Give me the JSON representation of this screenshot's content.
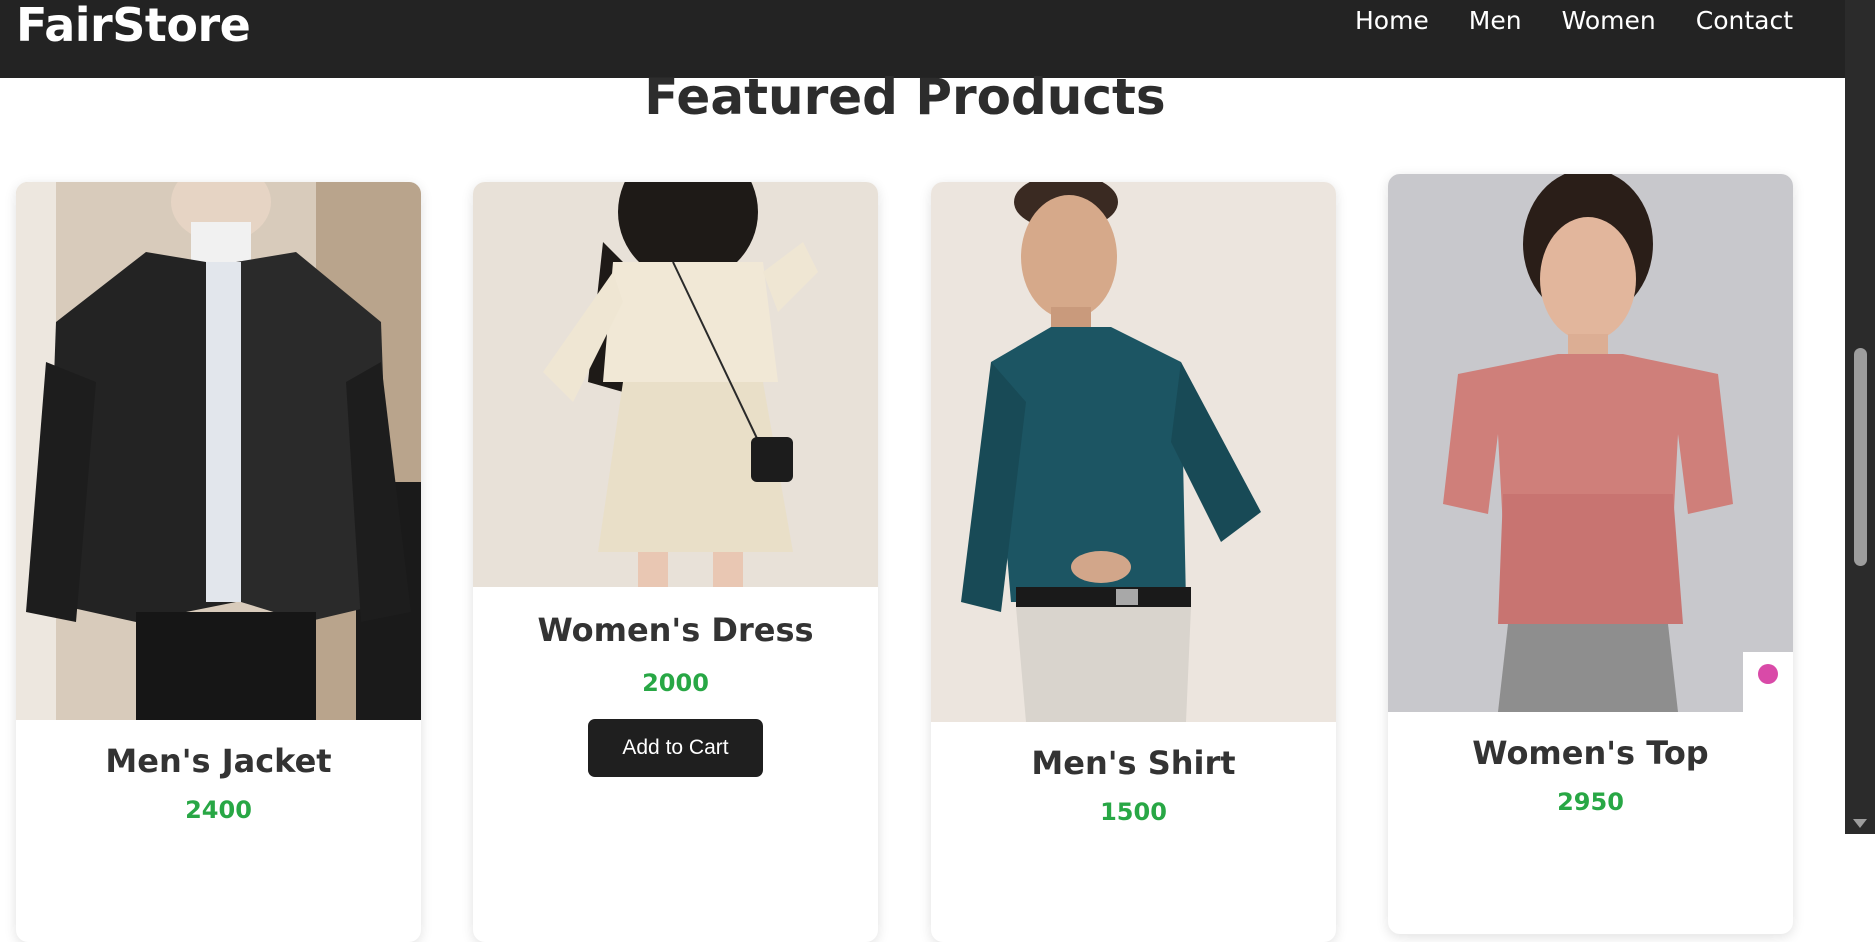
{
  "brand": {
    "name": "FairStore"
  },
  "nav": {
    "links": [
      "Home",
      "Men",
      "Women",
      "Contact"
    ]
  },
  "featured": {
    "title": "Featured Products",
    "products": [
      {
        "name": "Men's Jacket",
        "price": "2400"
      },
      {
        "name": "Women's Dress",
        "price": "2000",
        "button": "Add to Cart"
      },
      {
        "name": "Men's Shirt",
        "price": "1500"
      },
      {
        "name": "Women's Top",
        "price": "2950"
      }
    ]
  },
  "colors": {
    "navbar": "#232323",
    "price": "#28a745",
    "button": "#1f1f1f"
  }
}
